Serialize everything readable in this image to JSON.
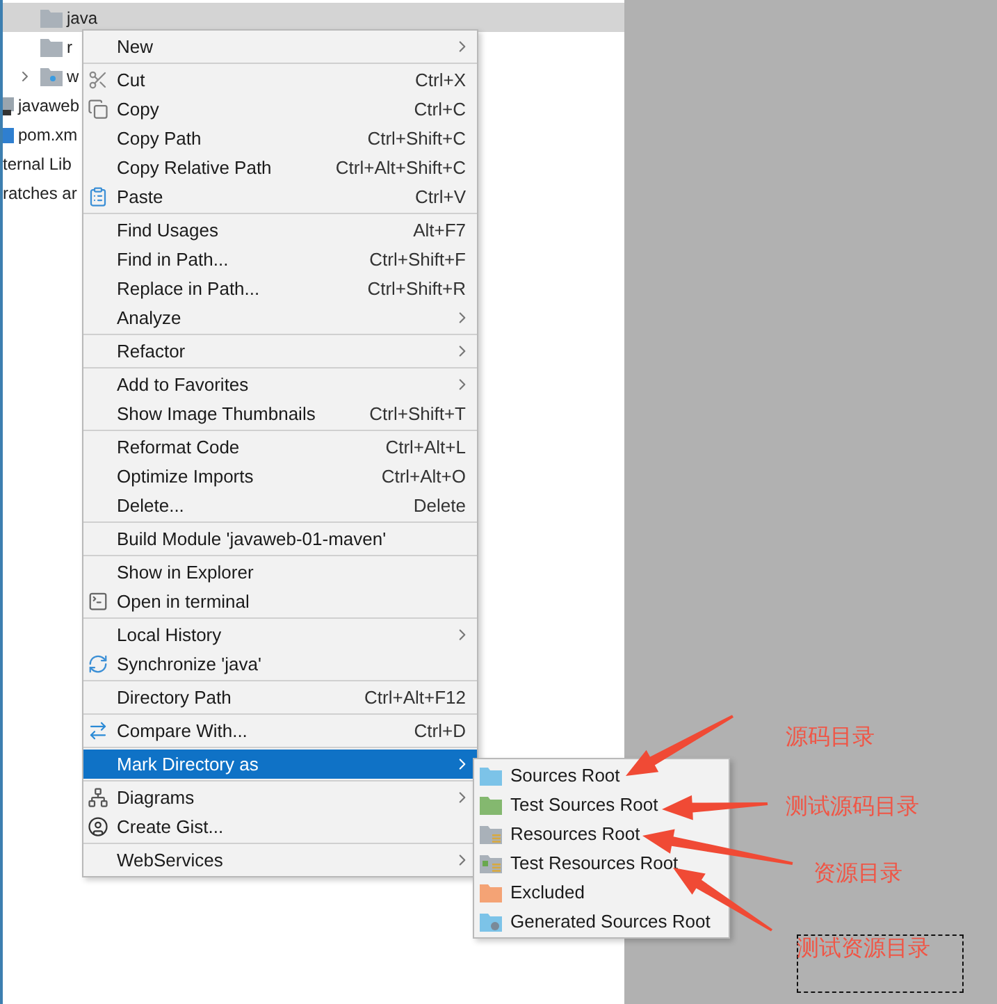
{
  "tree": {
    "folders": [
      {
        "label": "java",
        "selected": true,
        "kind": "plain",
        "expandable": false
      },
      {
        "label": "r",
        "selected": false,
        "kind": "plain",
        "expandable": false
      },
      {
        "label": "w",
        "selected": false,
        "kind": "web",
        "expandable": true
      }
    ],
    "files": [
      {
        "label": "javaweb",
        "kind": "module"
      },
      {
        "label": "pom.xm",
        "kind": "maven"
      },
      {
        "label": "ternal Lib",
        "kind": "none"
      },
      {
        "label": "ratches ar",
        "kind": "none"
      }
    ]
  },
  "context_menu": {
    "groups": [
      [
        {
          "label": "New",
          "submenu": true,
          "kind": "plain",
          "selected": false
        }
      ],
      [
        {
          "label": "Cut",
          "shortcut": "Ctrl+X",
          "submenu": false,
          "kind": "cut",
          "selected": false
        },
        {
          "label": "Copy",
          "shortcut": "Ctrl+C",
          "submenu": false,
          "kind": "copy",
          "selected": false
        },
        {
          "label": "Copy Path",
          "shortcut": "Ctrl+Shift+C",
          "submenu": false,
          "kind": "plain",
          "selected": false
        },
        {
          "label": "Copy Relative Path",
          "shortcut": "Ctrl+Alt+Shift+C",
          "submenu": false,
          "kind": "plain",
          "selected": false
        },
        {
          "label": "Paste",
          "shortcut": "Ctrl+V",
          "submenu": false,
          "kind": "paste",
          "selected": false
        }
      ],
      [
        {
          "label": "Find Usages",
          "shortcut": "Alt+F7",
          "submenu": false,
          "kind": "plain",
          "selected": false
        },
        {
          "label": "Find in Path...",
          "shortcut": "Ctrl+Shift+F",
          "submenu": false,
          "kind": "plain",
          "selected": false
        },
        {
          "label": "Replace in Path...",
          "shortcut": "Ctrl+Shift+R",
          "submenu": false,
          "kind": "plain",
          "selected": false
        },
        {
          "label": "Analyze",
          "submenu": true,
          "kind": "plain",
          "selected": false
        }
      ],
      [
        {
          "label": "Refactor",
          "submenu": true,
          "kind": "plain",
          "selected": false
        }
      ],
      [
        {
          "label": "Add to Favorites",
          "submenu": true,
          "kind": "plain",
          "selected": false
        },
        {
          "label": "Show Image Thumbnails",
          "shortcut": "Ctrl+Shift+T",
          "submenu": false,
          "kind": "plain",
          "selected": false
        }
      ],
      [
        {
          "label": "Reformat Code",
          "shortcut": "Ctrl+Alt+L",
          "submenu": false,
          "kind": "plain",
          "selected": false
        },
        {
          "label": "Optimize Imports",
          "shortcut": "Ctrl+Alt+O",
          "submenu": false,
          "kind": "plain",
          "selected": false
        },
        {
          "label": "Delete...",
          "shortcut": "Delete",
          "submenu": false,
          "kind": "plain",
          "selected": false
        }
      ],
      [
        {
          "label": "Build Module 'javaweb-01-maven'",
          "submenu": false,
          "kind": "plain",
          "selected": false
        }
      ],
      [
        {
          "label": "Show in Explorer",
          "submenu": false,
          "kind": "plain",
          "selected": false
        },
        {
          "label": "Open in terminal",
          "submenu": false,
          "kind": "terminal",
          "selected": false
        }
      ],
      [
        {
          "label": "Local History",
          "submenu": true,
          "kind": "plain",
          "selected": false
        },
        {
          "label": "Synchronize 'java'",
          "submenu": false,
          "kind": "sync",
          "selected": false
        }
      ],
      [
        {
          "label": "Directory Path",
          "shortcut": "Ctrl+Alt+F12",
          "submenu": false,
          "kind": "plain",
          "selected": false
        }
      ],
      [
        {
          "label": "Compare With...",
          "shortcut": "Ctrl+D",
          "submenu": false,
          "kind": "compare",
          "selected": false
        }
      ],
      [
        {
          "label": "Mark Directory as",
          "submenu": true,
          "kind": "plain",
          "selected": true
        }
      ],
      [
        {
          "label": "Diagrams",
          "submenu": true,
          "kind": "diagram",
          "selected": false
        },
        {
          "label": "Create Gist...",
          "submenu": false,
          "kind": "gist",
          "selected": false
        }
      ],
      [
        {
          "label": "WebServices",
          "submenu": true,
          "kind": "plain",
          "selected": false
        }
      ]
    ]
  },
  "submenu": [
    {
      "label": "Sources Root",
      "kind": "plain",
      "color": "#7cc3e8"
    },
    {
      "label": "Test Sources Root",
      "kind": "plain",
      "color": "#84b86f"
    },
    {
      "label": "Resources Root",
      "kind": "resources",
      "color": "#a9b1b9"
    },
    {
      "label": "Test Resources Root",
      "kind": "test-resources",
      "color": "#a9b1b9"
    },
    {
      "label": "Excluded",
      "kind": "plain",
      "color": "#f4a375"
    },
    {
      "label": "Generated Sources Root",
      "kind": "generated",
      "color": "#7cc3e8"
    }
  ],
  "annotations": [
    {
      "text": "源码目录",
      "boxed": false
    },
    {
      "text": "测试源码目录",
      "boxed": false
    },
    {
      "text": "资源目录",
      "boxed": false
    },
    {
      "text": "测试资源目录",
      "boxed": true
    }
  ]
}
